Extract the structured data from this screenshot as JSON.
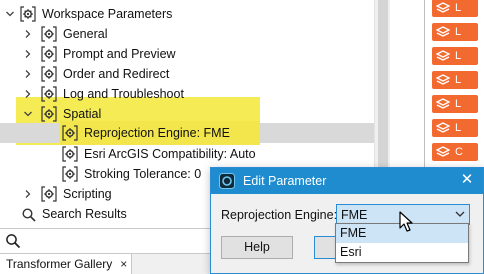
{
  "tree": {
    "items": [
      {
        "label": "Workspace Parameters",
        "expanded": true
      },
      {
        "label": "General"
      },
      {
        "label": "Prompt and Preview"
      },
      {
        "label": "Order and Redirect"
      },
      {
        "label": "Log and Troubleshoot"
      },
      {
        "label": "Spatial",
        "expanded": true
      },
      {
        "label": "Reprojection Engine: FME",
        "selected": true
      },
      {
        "label": "Esri ArcGIS Compatibility: Auto"
      },
      {
        "label": "Stroking Tolerance: 0"
      },
      {
        "label": "Scripting"
      },
      {
        "label": "Search Results"
      }
    ]
  },
  "strip": {
    "badges": [
      "L",
      "L",
      "L",
      "L",
      "L",
      "L",
      "C",
      "L",
      "L"
    ],
    "badge_color": "#f36a30"
  },
  "bottom": {
    "tab_label": "Transformer Gallery",
    "tab_close": "×"
  },
  "dialog": {
    "title": "Edit Parameter",
    "close_glyph": "✕",
    "field_label": "Reprojection Engine:",
    "combo_value": "FME",
    "options": [
      "FME",
      "Esri"
    ],
    "help_label": "Help"
  },
  "colors": {
    "accent": "#1e8ccf",
    "highlight": "#f5ec55",
    "selected_row": "#d9d9d9"
  }
}
